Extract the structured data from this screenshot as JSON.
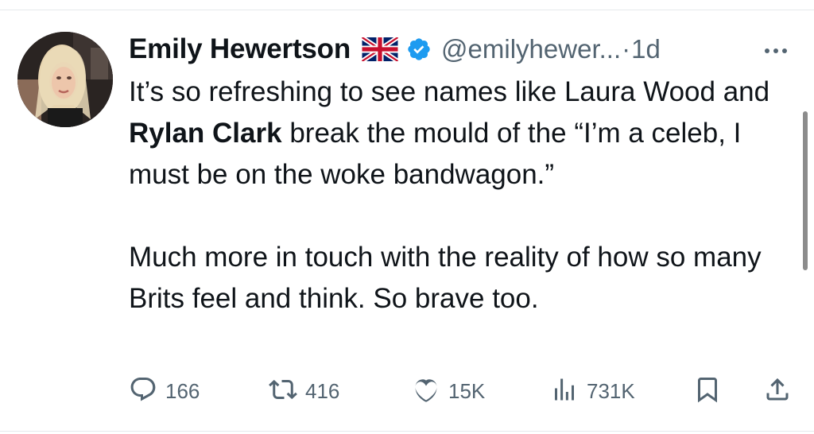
{
  "author": {
    "display_name": "Emily Hewertson",
    "handle": "@emilyhewer...",
    "separator": "·",
    "time": "1d"
  },
  "icons": {
    "flag": "uk-flag-icon",
    "verified": "verified-badge-icon",
    "more": "more-options-icon",
    "reply": "reply-icon",
    "repost": "repost-icon",
    "like": "heart-icon",
    "views": "views-icon",
    "bookmark": "bookmark-icon",
    "share": "share-icon"
  },
  "tweet": {
    "p1_a": "It’s so refreshing to see names like Laura Wood and ",
    "p1_bold": "Rylan Clark",
    "p1_b": " break the mould of the “I’m a celeb, I must be on the woke bandwagon.”",
    "p2": "Much more in touch with the reality of how so many Brits feel and think. So brave too."
  },
  "stats": {
    "replies": "166",
    "reposts": "416",
    "likes": "15K",
    "views": "731K"
  },
  "colors": {
    "text": "#0f1419",
    "secondary": "#536471",
    "verified": "#1d9bf0"
  }
}
